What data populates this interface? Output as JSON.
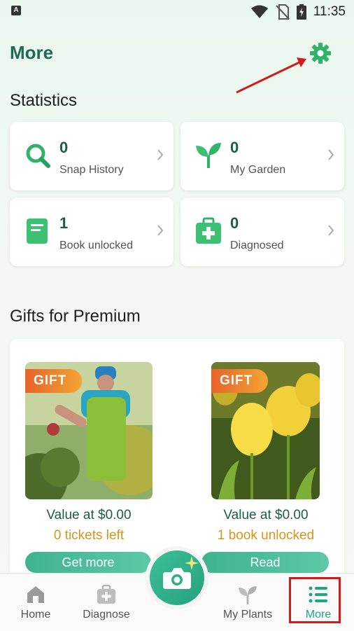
{
  "status_bar": {
    "carrier_icon_letter": "A",
    "time": "11:35"
  },
  "header": {
    "title": "More"
  },
  "statistics": {
    "title": "Statistics",
    "cards": [
      {
        "value": "0",
        "label": "Snap History",
        "icon": "search-icon"
      },
      {
        "value": "0",
        "label": "My Garden",
        "icon": "sprout-icon"
      },
      {
        "value": "1",
        "label": "Book unlocked",
        "icon": "book-icon"
      },
      {
        "value": "0",
        "label": "Diagnosed",
        "icon": "medical-kit-icon"
      }
    ]
  },
  "gifts": {
    "title": "Gifts for Premium",
    "items": [
      {
        "badge": "GIFT",
        "value": "Value at $0.00",
        "sub": "0 tickets left",
        "button": "Get more"
      },
      {
        "badge": "GIFT",
        "value": "Value at $0.00",
        "sub": "1 book unlocked",
        "button": "Read"
      }
    ]
  },
  "nav": {
    "items": [
      {
        "label": "Home"
      },
      {
        "label": "Diagnose"
      },
      {
        "label": "My Plants"
      },
      {
        "label": "More"
      }
    ]
  },
  "colors": {
    "accent": "#1fa57f",
    "title_green": "#1d6b52",
    "gift_orange": "#d9941a",
    "annotation_red": "#d41b1b"
  }
}
